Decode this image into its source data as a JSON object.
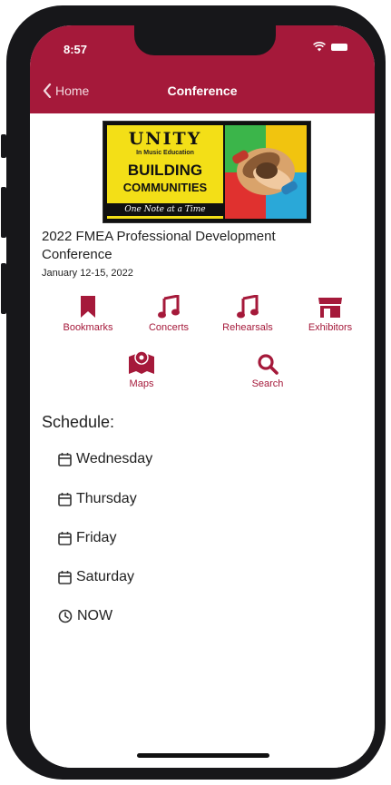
{
  "status_bar": {
    "time": "8:57"
  },
  "nav": {
    "back_label": "Home",
    "title": "Conference"
  },
  "banner": {
    "line1": "UNITY",
    "line2": "In Music Education",
    "line3": "BUILDING",
    "line4": "COMMUNITIES",
    "line5": "One Note at a Time"
  },
  "conference": {
    "title": "2022 FMEA Professional Development Conference",
    "dates": "January 12-15, 2022"
  },
  "categories": [
    {
      "label": "Bookmarks",
      "icon": "bookmark-icon"
    },
    {
      "label": "Concerts",
      "icon": "music-note-icon"
    },
    {
      "label": "Rehearsals",
      "icon": "music-note-icon"
    },
    {
      "label": "Exhibitors",
      "icon": "store-icon"
    },
    {
      "label": "Maps",
      "icon": "map-icon"
    },
    {
      "label": "Search",
      "icon": "search-icon"
    }
  ],
  "schedule": {
    "heading": "Schedule:",
    "days": [
      {
        "label": "Wednesday",
        "icon": "calendar-icon"
      },
      {
        "label": "Thursday",
        "icon": "calendar-icon"
      },
      {
        "label": "Friday",
        "icon": "calendar-icon"
      },
      {
        "label": "Saturday",
        "icon": "calendar-icon"
      },
      {
        "label": "NOW",
        "icon": "clock-icon"
      }
    ]
  },
  "colors": {
    "accent": "#a5193a",
    "frame": "#17171a",
    "banner_yellow": "#f3df17"
  }
}
